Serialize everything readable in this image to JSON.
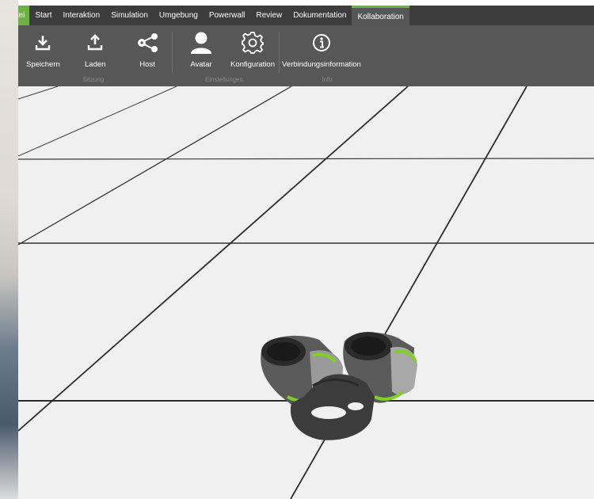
{
  "menu": {
    "tabs": [
      {
        "label": "Datei"
      },
      {
        "label": "Start"
      },
      {
        "label": "Interaktion"
      },
      {
        "label": "Simulation"
      },
      {
        "label": "Umgebung"
      },
      {
        "label": "Powerwall"
      },
      {
        "label": "Review"
      },
      {
        "label": "Dokumentation"
      },
      {
        "label": "Kollaboration"
      }
    ],
    "active_tab": "Kollaboration"
  },
  "ribbon": {
    "buttons": {
      "save": "Speichern",
      "load": "Laden",
      "host": "Host",
      "avatar": "Avatar",
      "config": "Konfiguration",
      "info": "Verbindungsinformation"
    },
    "groups": {
      "session": "Sitzung",
      "settings": "Einstellungen",
      "info": "Info"
    },
    "icons": {
      "save": "download-icon",
      "load": "upload-icon",
      "host": "share-icon",
      "avatar": "user-icon",
      "config": "gear-icon",
      "info": "info-icon"
    }
  },
  "colors": {
    "accent": "#6db33f",
    "menubar": "#3c3c3c",
    "ribbon": "#575757",
    "floor": "#f0f0f0",
    "gridline": "#2e2e2e"
  }
}
